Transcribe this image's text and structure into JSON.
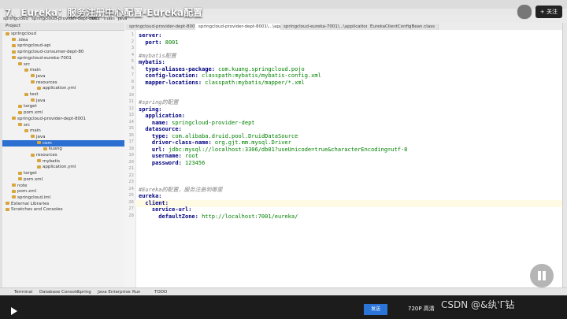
{
  "video": {
    "title": "7、Eureka：服务注册中心配置-Eureka配置",
    "follow_label": "+ 关注"
  },
  "navbar": {
    "breadcrumbs": [
      "springcloud",
      "springcloud-provider-dept-8001",
      "src",
      "main",
      "java"
    ]
  },
  "sidebar": {
    "header": "Project",
    "items": [
      {
        "label": "springcloud",
        "selected": false
      },
      {
        "label": ".idea",
        "selected": false
      },
      {
        "label": "springcloud-api",
        "selected": false
      },
      {
        "label": "springcloud-consumer-dept-80",
        "selected": false
      },
      {
        "label": "springcloud-eureka-7001",
        "selected": false
      },
      {
        "label": "src",
        "selected": false
      },
      {
        "label": "main",
        "selected": false
      },
      {
        "label": "java",
        "selected": false
      },
      {
        "label": "resources",
        "selected": false
      },
      {
        "label": "application.yml",
        "selected": false
      },
      {
        "label": "test",
        "selected": false
      },
      {
        "label": "java",
        "selected": false
      },
      {
        "label": "target",
        "selected": false
      },
      {
        "label": "pom.xml",
        "selected": false
      },
      {
        "label": "springcloud-provider-dept-8001",
        "selected": false
      },
      {
        "label": "src",
        "selected": false
      },
      {
        "label": "main",
        "selected": false
      },
      {
        "label": "java",
        "selected": false
      },
      {
        "label": "com",
        "selected": true
      },
      {
        "label": "kuang",
        "selected": false
      },
      {
        "label": "resources",
        "selected": false
      },
      {
        "label": "mybatis",
        "selected": false
      },
      {
        "label": "application.yml",
        "selected": false
      },
      {
        "label": "target",
        "selected": false
      },
      {
        "label": "pom.xml",
        "selected": false
      },
      {
        "label": "note",
        "selected": false
      },
      {
        "label": "pom.xml",
        "selected": false
      },
      {
        "label": "springcloud.iml",
        "selected": false
      },
      {
        "label": "External Libraries",
        "selected": false
      },
      {
        "label": "Scratches and Consoles",
        "selected": false
      }
    ]
  },
  "tabs": [
    {
      "label": "springcloud-provider-dept-8001",
      "active": false
    },
    {
      "label": "springcloud-provider-dept-8001\\...\\application.yml",
      "active": true
    },
    {
      "label": "springcloud-eureka-7001\\...\\application.yml",
      "active": false
    },
    {
      "label": "EurekaClientConfigBean.class",
      "active": false
    }
  ],
  "editor": {
    "lines": [
      {
        "n": "1",
        "text": "server:"
      },
      {
        "n": "2",
        "text": "  port: 8001"
      },
      {
        "n": "3",
        "text": ""
      },
      {
        "n": "4",
        "text": "#mybatis配置"
      },
      {
        "n": "5",
        "text": "mybatis:"
      },
      {
        "n": "6",
        "text": "  type-aliases-package: com.kuang.springcloud.pojo"
      },
      {
        "n": "7",
        "text": "  config-location: classpath:mybatis/mybatis-config.xml"
      },
      {
        "n": "8",
        "text": "  mapper-locations: classpath:mybatis/mapper/*.xml"
      },
      {
        "n": "9",
        "text": ""
      },
      {
        "n": "10",
        "text": ""
      },
      {
        "n": "11",
        "text": "#spring的配置"
      },
      {
        "n": "12",
        "text": "spring:"
      },
      {
        "n": "13",
        "text": "  application:"
      },
      {
        "n": "14",
        "text": "    name: springcloud-provider-dept"
      },
      {
        "n": "15",
        "text": "  datasource:"
      },
      {
        "n": "16",
        "text": "    type: com.alibaba.druid.pool.DruidDataSource"
      },
      {
        "n": "17",
        "text": "    driver-class-name: org.gjt.mm.mysql.Driver"
      },
      {
        "n": "18",
        "text": "    url: jdbc:mysql://localhost:3306/db01?useUnicode=true&characterEncoding=utf-8"
      },
      {
        "n": "19",
        "text": "    username: root"
      },
      {
        "n": "20",
        "text": "    password: 123456"
      },
      {
        "n": "21",
        "text": ""
      },
      {
        "n": "22",
        "text": ""
      },
      {
        "n": "23",
        "text": ""
      },
      {
        "n": "24",
        "text": "#Eureka的配置，服务注册到哪里"
      },
      {
        "n": "25",
        "text": "eureka:"
      },
      {
        "n": "26",
        "text": "  client:"
      },
      {
        "n": "27",
        "text": "    service-url:"
      },
      {
        "n": "28",
        "text": "      defaultZone: http://localhost:7001/eureka/"
      }
    ],
    "current_line": 26
  },
  "bottom_tools": [
    {
      "label": "Terminal"
    },
    {
      "label": "Database Console"
    },
    {
      "label": "Spring"
    },
    {
      "label": "Java Enterprise"
    },
    {
      "label": "Run"
    },
    {
      "label": "TODO"
    }
  ],
  "player": {
    "send_label": "发送",
    "quality_label": "720P 高清"
  },
  "watermark": "CSDN @&纨'Γ钻"
}
